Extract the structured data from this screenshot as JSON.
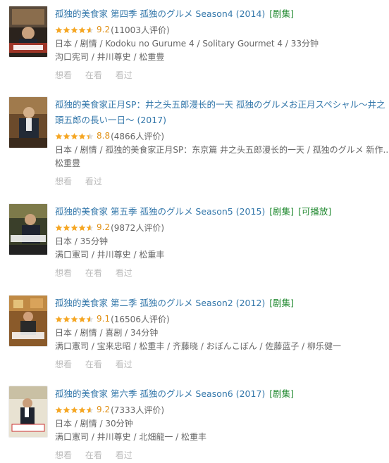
{
  "items": [
    {
      "title": "孤独的美食家 第四季 孤独のグルメ Season4 (2014)",
      "tags": [
        "[剧集]"
      ],
      "rating": 9.2,
      "score_text": "9.2",
      "votes": "(11003人评价)",
      "meta_lines": [
        "日本 / 剧情 / Kodoku no Gurume 4 / Solitary Gourmet 4 / 33分钟",
        "沟口宪司 / 井川尊史 / 松重豊"
      ],
      "actions": [
        "想看",
        "在看",
        "看过"
      ]
    },
    {
      "title": "孤独的美食家正月SP：井之头五郎漫长的一天 孤独のグルメお正月スペシャル～井之頭五郎の長い一日～ (2017)",
      "tags": [],
      "rating": 8.8,
      "score_text": "8.8",
      "votes": "(4866人评价)",
      "meta_lines": [
        "日本 / 剧情 / 孤独的美食家正月SP：东京篇 井之头五郎漫长的一天 / 孤独のグルメ 新作...",
        "松重豊"
      ],
      "actions": [
        "想看",
        "看过"
      ]
    },
    {
      "title": "孤独的美食家 第五季 孤独のグルメ Season5 (2015)",
      "tags": [
        "[剧集]",
        "[可播放]"
      ],
      "rating": 9.2,
      "score_text": "9.2",
      "votes": "(9872人评价)",
      "meta_lines": [
        "日本 / 35分钟",
        "满口憲司 / 井川尊史 / 松重丰"
      ],
      "actions": [
        "想看",
        "在看",
        "看过"
      ]
    },
    {
      "title": "孤独的美食家 第二季 孤独のグルメ Season2 (2012)",
      "tags": [
        "[剧集]"
      ],
      "rating": 9.1,
      "score_text": "9.1",
      "votes": "(16506人评价)",
      "meta_lines": [
        "日本 / 剧情 / 喜剧 / 34分钟",
        "满口憲司 / 宝来忠昭 / 松重丰 / 齐藤晓 / おぼんこぼん / 佐藤蓝子 / 柳乐健一"
      ],
      "actions": [
        "想看",
        "在看",
        "看过"
      ]
    },
    {
      "title": "孤独的美食家 第六季 孤独のグルメ Season6 (2017)",
      "tags": [
        "[剧集]"
      ],
      "rating": 9.2,
      "score_text": "9.2",
      "votes": "(7333人评价)",
      "meta_lines": [
        "日本 / 剧情 / 30分钟",
        "满口憲司 / 井川尊史 / 北畑龍一 / 松重丰"
      ],
      "actions": [
        "想看",
        "在看",
        "看过"
      ]
    }
  ],
  "colors": {
    "link": "#3377aa",
    "tag": "#228a31",
    "star": "#f5a623",
    "score": "#e09015",
    "meta": "#666666",
    "action": "#bbbbbb"
  },
  "icons": {
    "star": "star-icon",
    "poster": "poster-thumbnail"
  }
}
